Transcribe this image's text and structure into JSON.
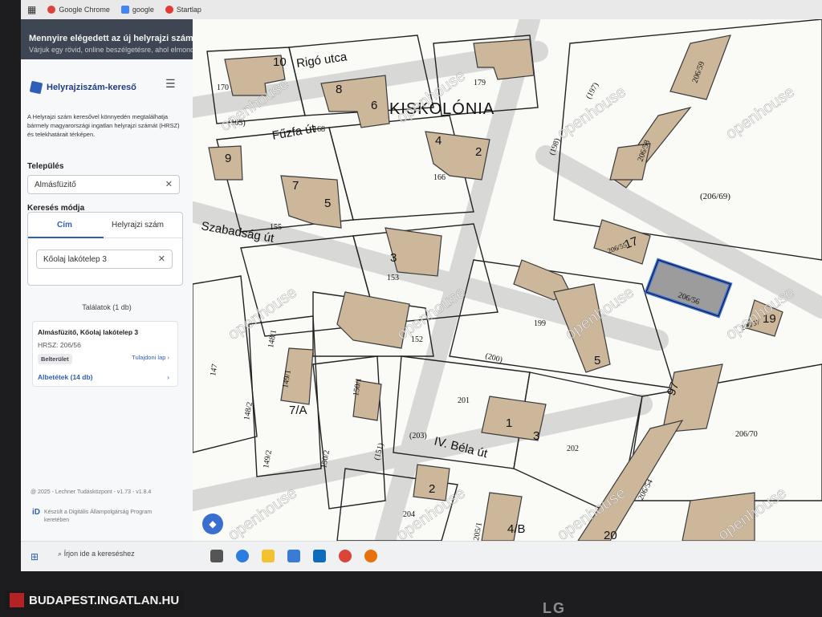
{
  "browser": {
    "bookmarks": [
      "Google Chrome",
      "google",
      "Startlap"
    ]
  },
  "banner": {
    "title": "Mennyire elégedett az új helyrajzi szám kereső felületével?",
    "subtitle": "Várjuk egy rövid, online beszélgetésre, ahol elmondhatja, hogyan működött a kereső és mit tehetnénk jobbá."
  },
  "sidebar": {
    "app_title": "Helyrajziszám-kereső",
    "intro": "A Helyrajzi szám keresővel könnyedén megtalálhatja bármely magyarországi ingatlan helyrajzi számát (HRSZ) és telekhatárait térképen.",
    "settlement_label": "Település",
    "settlement_value": "Almásfüzitő",
    "mode_label": "Keresés módja",
    "tab_address": "Cím",
    "tab_hrsz": "Helyrajzi szám",
    "address_value": "Kőolaj lakótelep 3",
    "results_title": "Találatok (1 db)",
    "result": {
      "title": "Almásfüzitő, Kőolaj lakótelep 3",
      "hrsz": "HRSZ: 206/56",
      "badge": "Belterület",
      "owner_link": "Tulajdoni lap",
      "sub": "Albetétek (14 db)"
    },
    "footer_copyright": "@ 2025 - Lechner Tudásközpont - v1.73 - v1.8.4",
    "footer_program": "Készült a Digitális Állampolgárság Program keretében"
  },
  "map": {
    "place": "KISKOLÓNIA",
    "streets": [
      "Rigó utca",
      "Fűzfa út",
      "Szabadság út",
      "IV. Béla út"
    ],
    "lots": [
      "170",
      "179",
      "168",
      "166",
      "155",
      "153",
      "(165)",
      "(198)",
      "(197)",
      "206/59",
      "206/58",
      "(206/69)",
      "206/55",
      "206/56",
      "206/57",
      "199",
      "152",
      "148/1",
      "147",
      "149/1",
      "150/1",
      "148/2",
      "149/2",
      "150/2",
      "(151)",
      "(200)",
      "201",
      "202",
      "(203)",
      "204",
      "205/1",
      "206/70",
      "206/54",
      "20"
    ],
    "house_numbers": [
      "10",
      "8",
      "6",
      "4",
      "2",
      "9",
      "7",
      "5",
      "3",
      "17",
      "19",
      "5",
      "97",
      "1",
      "3",
      "2",
      "7/A",
      "4/B",
      "20"
    ],
    "watermark": "openhouse"
  },
  "taskbar": {
    "search_placeholder": "Írjon ide a kereséshez"
  },
  "brand": "BUDAPEST.INGATLAN.HU",
  "monitor": "LG",
  "colors": {
    "accent": "#2f5fb6",
    "building": "#cdb79b",
    "highlight": "#3b6fe0"
  }
}
